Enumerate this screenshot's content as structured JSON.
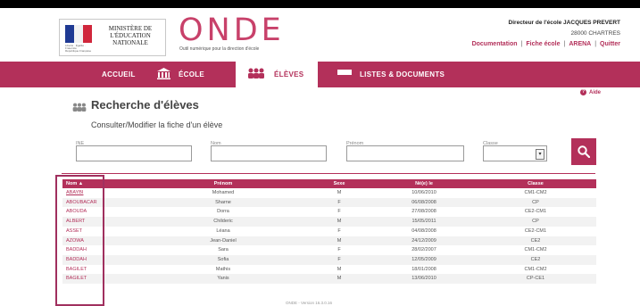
{
  "header": {
    "ministere": "MINISTÈRE DE L'ÉDUCATION NATIONALE",
    "app_name": "ONDE",
    "app_subtitle": "Outil numérique pour la direction d'école",
    "director": "Directeur de l'école JACQUES PREVERT",
    "city": "28000 CHARTRES",
    "links": [
      "Documentation",
      "Fiche école",
      "ARENA",
      "Quitter"
    ]
  },
  "nav": {
    "items": [
      {
        "label": "ACCUEIL",
        "icon": "grid-icon"
      },
      {
        "label": "ÉCOLE",
        "icon": "building-icon"
      },
      {
        "label": "ÉLÈVES",
        "icon": "students-icon",
        "active": true
      },
      {
        "label": "LISTES & DOCUMENTS",
        "icon": "list-icon"
      }
    ]
  },
  "page": {
    "help": "Aide",
    "title": "Recherche d'élèves",
    "subtitle": "Consulter/Modifier la fiche d'un élève"
  },
  "search": {
    "ine_label": "INE",
    "nom_label": "Nom",
    "prenom_label": "Prénom",
    "classe_label": "Classe"
  },
  "table": {
    "headers": [
      "Nom",
      "Prénom",
      "Sexe",
      "Né(e) le",
      "Classe"
    ],
    "rows": [
      [
        "ABAYBI",
        "Mohamed",
        "M",
        "10/06/2010",
        "CM1-CM2"
      ],
      [
        "ABOUBACAR",
        "Sharne",
        "F",
        "06/08/2008",
        "CP"
      ],
      [
        "ABOUDA",
        "Dorra",
        "F",
        "27/08/2008",
        "CE2-CM1"
      ],
      [
        "ALBERT",
        "Childeric",
        "M",
        "15/05/2011",
        "CP"
      ],
      [
        "ASSET",
        "Léana",
        "F",
        "04/08/2008",
        "CE2-CM1"
      ],
      [
        "AZOWA",
        "Jean-Daniel",
        "M",
        "24/12/2009",
        "CE2"
      ],
      [
        "BADDAH",
        "Sara",
        "F",
        "28/02/2007",
        "CM1-CM2"
      ],
      [
        "BADDAH",
        "Sofia",
        "F",
        "12/05/2009",
        "CE2"
      ],
      [
        "BAGILET",
        "Mathis",
        "M",
        "18/01/2008",
        "CM1-CM2"
      ],
      [
        "BAGILET",
        "Yanis",
        "M",
        "13/06/2010",
        "CP-CE1"
      ]
    ]
  },
  "footer": {
    "version": "ONDE - Version 16.3.0.16"
  },
  "colors": {
    "accent": "#b3305a",
    "row_alt": "#f2f2f2"
  }
}
